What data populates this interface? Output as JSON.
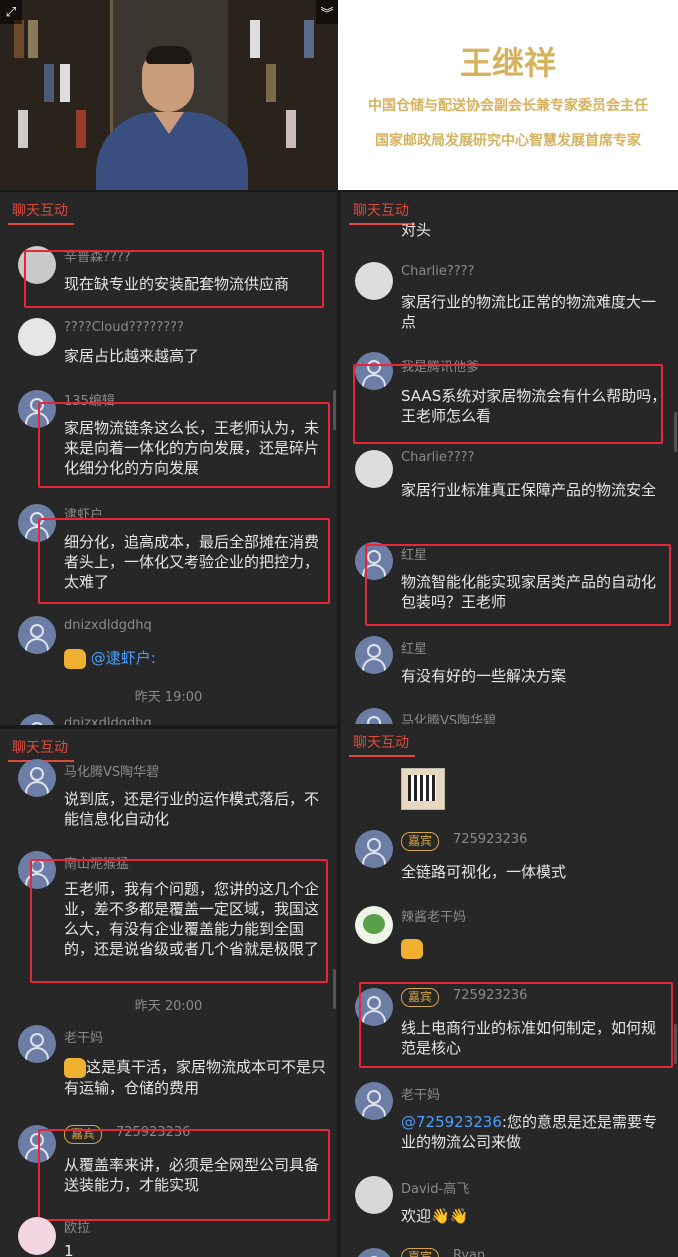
{
  "speaker": {
    "name": "王继祥",
    "title1": "中国仓储与配送协会副会长兼专家委员会主任",
    "title2": "国家邮政局发展研究中心智慧发展首席专家"
  },
  "panels": {
    "p1": {
      "title": "聊天互动",
      "messages": [
        {
          "user": "辛普森????",
          "text": "现在缺专业的安装配套物流供应商"
        },
        {
          "user": "????Cloud????????",
          "text": "家居占比越来越高了"
        },
        {
          "user": "135编辑",
          "text": "家居物流链条这么长，王老师认为，未来是向着一体化的方向发展，还是碎片化细分化的方向发展"
        },
        {
          "user": "逮虾户",
          "text": "细分化，追高成本，最后全部摊在消费者头上，一体化又考验企业的把控力，太难了"
        },
        {
          "user": "dnizxdldgdhq",
          "mention": "@逮虾户:"
        }
      ],
      "time": "昨天 19:00",
      "cut_user": "dnizxdldgdhq"
    },
    "p2": {
      "title": "聊天互动",
      "top_cut": "对头",
      "messages": [
        {
          "user": "Charlie????",
          "text": "家居行业的物流比正常的物流难度大一点"
        },
        {
          "user": "我是腾讯他爹",
          "text": "SAAS系统对家居物流会有什么帮助吗，王老师怎么看"
        },
        {
          "user": "Charlie????",
          "text": "家居行业标准真正保障产品的物流安全"
        },
        {
          "user": "红星",
          "text": "物流智能化能实现家居类产品的自动化包装吗？王老师"
        },
        {
          "user": "红星",
          "text": "有没有好的一些解决方案"
        }
      ],
      "cut_user": "马化腾VS陶华碧"
    },
    "p3": {
      "title": "聊天互动",
      "messages": [
        {
          "user": "马化腾VS陶华碧",
          "text": "说到底，还是行业的运作模式落后，不能信息化自动化"
        },
        {
          "user": "南山泥猴猛",
          "text": "王老师，我有个问题，您讲的这几个企业，差不多都是覆盖一定区域，我国这么大，有没有企业覆盖能力能到全国的，还是说省级或者几个省就是极限了"
        },
        {
          "user": "老干妈",
          "text": "这是真干活，家居物流成本可不是只有运输，仓储的费用"
        },
        {
          "badge": "嘉宾",
          "user": "725923236",
          "text": "从覆盖率来讲，必须是全网型公司具备送装能力，才能实现"
        },
        {
          "user": "欧拉",
          "text": "1"
        }
      ],
      "time": "昨天 20:00"
    },
    "p4": {
      "title": "聊天互动",
      "messages": [
        {
          "badge": "嘉宾",
          "user": "725923236",
          "text": "全链路可视化，一体模式"
        },
        {
          "user": "辣酱老干妈",
          "text": ""
        },
        {
          "badge": "嘉宾",
          "user": "725923236",
          "text": "线上电商行业的标准如何制定，如何规范是核心"
        },
        {
          "user": "老干妈",
          "mention": "@725923236",
          "text": ":您的意思是还是需要专业的物流公司来做"
        },
        {
          "user": "David-高飞",
          "text": "欢迎👋👋"
        }
      ],
      "cut_badge": "嘉宾",
      "cut_user": "Ryan"
    }
  },
  "colors": {
    "accent": "#e04a3c",
    "highlight": "#e8263a",
    "gold": "#d6b25c",
    "mention": "#4a9fff"
  }
}
